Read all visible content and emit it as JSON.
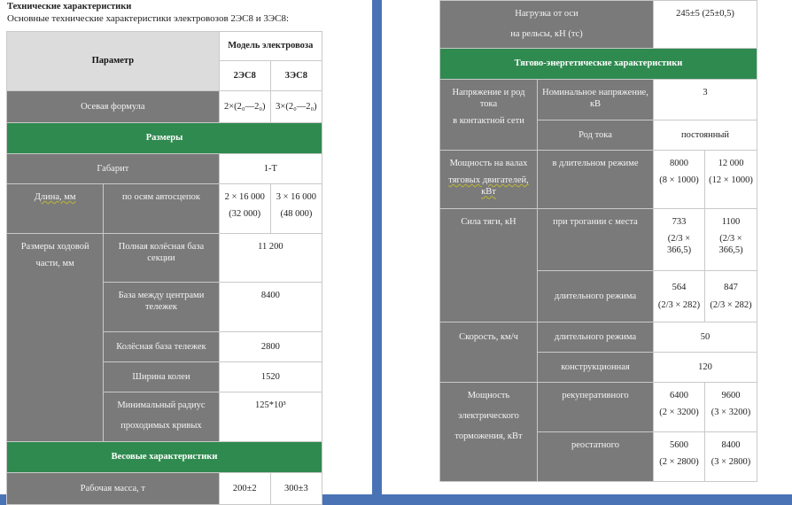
{
  "left": {
    "heading": "Технические характеристики",
    "subheading": "Основные технические характеристики электровозов 2ЭС8 и 3ЭС8:",
    "header": {
      "parameter": "Параметр",
      "model": "Модель электровоза",
      "col_a": "2ЭС8",
      "col_b": "3ЭС8"
    },
    "axial": {
      "label": "Осевая формула",
      "a": "2×(2₀—2₀)",
      "b": "3×(2₀—2₀)"
    },
    "section_dimensions": "Размеры",
    "gabarit": {
      "label": "Габарит",
      "value": "1-Т"
    },
    "length": {
      "label": "Длина, мм",
      "sub": "по осям автосцепок",
      "a1": "2 × 16 000",
      "a2": "(32 000)",
      "b1": "3 × 16 000",
      "b2": "(48 000)"
    },
    "running_gear": {
      "label_l1": "Размеры ходовой",
      "label_l2": "части, мм",
      "rows": [
        {
          "label": "Полная колёсная база секции",
          "value": "11 200"
        },
        {
          "label": "База между центрами тележек",
          "value": "8400"
        },
        {
          "label": "Колёсная база тележек",
          "value": "2800"
        },
        {
          "label": "Ширина колеи",
          "value": "1520"
        },
        {
          "label_l1": "Минимальный радиус",
          "label_l2": "проходимых кривых",
          "value": "125*10³"
        }
      ]
    },
    "section_weight": "Весовые характеристики",
    "mass": {
      "label": "Рабочая масса, т",
      "a": "200±2",
      "b": "300±3"
    }
  },
  "right": {
    "axle_load": {
      "label_l1": "Нагрузка от оси",
      "label_l2": "на рельсы, кН (тс)",
      "value": "245±5 (25±0,5)"
    },
    "section_traction": "Тягово-энергетические характеристики",
    "voltage": {
      "label_l1": "Напряжение и род тока",
      "label_l2": "в контактной сети",
      "nominal_label": "Номинальное напряжение, кВ",
      "nominal_value": "3",
      "current_label": "Род тока",
      "current_value": "постоянный"
    },
    "power": {
      "label_l1": "Мощность на валах",
      "label_l2": "тяговых двигателей, кВт",
      "sub": "в длительном режиме",
      "a1": "8000",
      "a2": "(8 × 1000)",
      "b1": "12 000",
      "b2": "(12 × 1000)"
    },
    "traction_force": {
      "label": "Сила тяги, кН",
      "start_label": "при трогании с места",
      "start_a1": "733",
      "start_a2": "(2/3 × 366,5)",
      "start_b1": "1100",
      "start_b2": "(2/3 × 366,5)",
      "cont_label": "длительного режима",
      "cont_a1": "564",
      "cont_a2": "(2/3 × 282)",
      "cont_b1": "847",
      "cont_b2": "(2/3 × 282)"
    },
    "speed": {
      "label": "Скорость, км/ч",
      "cont_label": "длительного режима",
      "cont_value": "50",
      "design_label": "конструкционная",
      "design_value": "120"
    },
    "braking": {
      "label_l1": "Мощность",
      "label_l2": "электрического",
      "label_l3": "торможения, кВт",
      "regen_label": "рекуперативного",
      "regen_a1": "6400",
      "regen_a2": "(2 × 3200)",
      "regen_b1": "9600",
      "regen_b2": "(3 × 3200)",
      "rheo_label": "реостатного",
      "rheo_a1": "5600",
      "rheo_a2": "(2 × 2800)",
      "rheo_b1": "8400",
      "rheo_b2": "(3 × 2800)"
    }
  },
  "colors": {
    "background": "#4a73b5",
    "section_green": "#2f8a4f",
    "label_gray": "#7a7a7a",
    "header_gray": "#dcdcdc"
  }
}
